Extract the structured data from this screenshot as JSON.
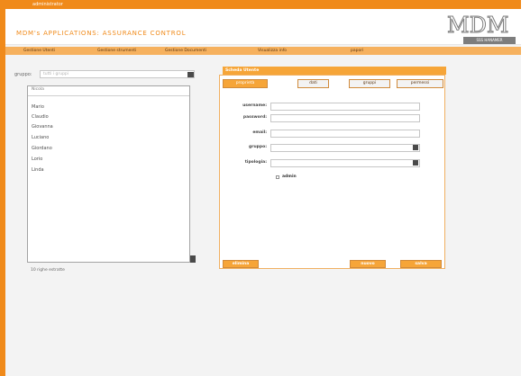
{
  "top_bar": {
    "text": "administrator"
  },
  "header": {
    "title": "MDM's APPLICATIONS: ASSURANCE CONTROL",
    "logo_text": "MDM",
    "logo_sub": "SSS HANAMER"
  },
  "nav": {
    "items": [
      {
        "label": "Gestione Utenti"
      },
      {
        "label": "Gestione strumenti"
      },
      {
        "label": "Gestione Documenti"
      },
      {
        "label": "Visualizza info"
      },
      {
        "label": "papori"
      }
    ]
  },
  "filter": {
    "gruppo_label": "gruppo:",
    "gruppo_placeholder": "tutti i gruppi"
  },
  "user_list": {
    "header": "Nicola",
    "items": [
      "Mario",
      "Claudio",
      "Giovanna",
      "Luciano",
      "Giordano",
      "Lorio",
      "Linda"
    ],
    "record_count": "10 righe estratte"
  },
  "form": {
    "title": "Scheda Utente",
    "tabs": [
      {
        "label": "proprietà"
      },
      {
        "label": "dati"
      },
      {
        "label": "gruppi"
      },
      {
        "label": "permessi"
      }
    ],
    "fields": {
      "username": {
        "label": "username:"
      },
      "password": {
        "label": "password:"
      },
      "email": {
        "label": "email:"
      },
      "gruppo": {
        "label": "gruppo:"
      },
      "tipologia": {
        "label": "tipologia:"
      }
    },
    "admin_label": "admin",
    "buttons": {
      "elimina": "elimina",
      "nuovo": "nuovo",
      "salva": "salva"
    }
  },
  "colors": {
    "accent": "#f08a1a",
    "nav_bg": "#f6b15e",
    "tab_bg": "#f6a538"
  }
}
